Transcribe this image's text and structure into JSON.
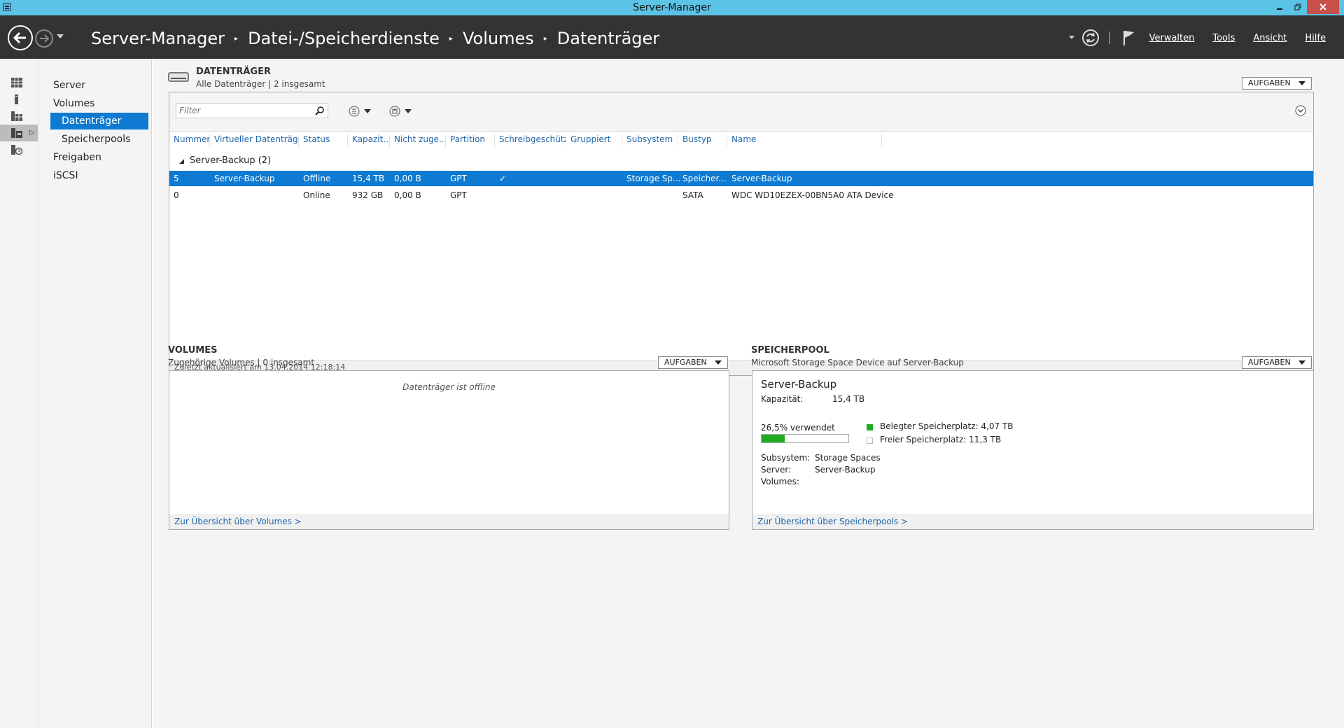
{
  "window": {
    "title": "Server-Manager"
  },
  "header": {
    "breadcrumb": [
      "Server-Manager",
      "Datei-/Speicherdienste",
      "Volumes",
      "Datenträger"
    ],
    "menu": [
      "Verwalten",
      "Tools",
      "Ansicht",
      "Hilfe"
    ]
  },
  "subnav": {
    "items": [
      {
        "label": "Server"
      },
      {
        "label": "Volumes"
      },
      {
        "label": "Datenträger",
        "active": true
      },
      {
        "label": "Speicherpools"
      },
      {
        "label": "Freigaben"
      },
      {
        "label": "iSCSI"
      }
    ]
  },
  "disks": {
    "title": "DATENTRÄGER",
    "subtitle": "Alle Datenträger | 2 insgesamt",
    "tasks_label": "AUFGABEN",
    "filter_placeholder": "Filter",
    "columns": [
      "Nummer",
      "Virtueller Datenträger",
      "Status",
      "Kapazit...",
      "Nicht zuge...",
      "Partition",
      "Schreibgeschützt",
      "Gruppiert",
      "Subsystem",
      "Bustyp",
      "Name"
    ],
    "group_label": "Server-Backup (2)",
    "rows": [
      {
        "nummer": "5",
        "virtuell": "Server-Backup",
        "status": "Offline",
        "kapazitaet": "15,4 TB",
        "nicht_zugeordnet": "0,00 B",
        "partition": "GPT",
        "schreibgeschuetzt": "✓",
        "gruppiert": "",
        "subsystem": "Storage Sp...",
        "bustyp": "Speicher...",
        "name": "Server-Backup",
        "selected": true
      },
      {
        "nummer": "0",
        "virtuell": "",
        "status": "Online",
        "kapazitaet": "932 GB",
        "nicht_zugeordnet": "0,00 B",
        "partition": "GPT",
        "schreibgeschuetzt": "",
        "gruppiert": "",
        "subsystem": "",
        "bustyp": "SATA",
        "name": "WDC WD10EZEX-00BN5A0 ATA Device",
        "selected": false
      }
    ],
    "footer": "Zuletzt aktualisiert am 13.04.2014 12:18:14"
  },
  "volumes": {
    "title": "VOLUMES",
    "subtitle": "Zugehörige Volumes | 0 insgesamt",
    "tasks_label": "AUFGABEN",
    "message": "Datenträger ist offline",
    "link": "Zur Übersicht über Volumes >"
  },
  "pool": {
    "title": "SPEICHERPOOL",
    "subtitle": "Microsoft Storage Space Device auf Server-Backup",
    "tasks_label": "AUFGABEN",
    "name": "Server-Backup",
    "capacity_label": "Kapazität:",
    "capacity_value": "15,4 TB",
    "used_text": "26,5% verwendet",
    "used_fraction": 0.265,
    "legend_used": "Belegter Speicherplatz: 4,07 TB",
    "legend_free": "Freier Speicherplatz: 11,3 TB",
    "subsystem_label": "Subsystem:",
    "subsystem_value": "Storage Spaces",
    "server_label": "Server:",
    "server_value": "Server-Backup",
    "volumes_label": "Volumes:",
    "link": "Zur Übersicht über Speicherpools >",
    "used_color": "#22aa22"
  },
  "colors": {
    "accent": "#0e7ad1",
    "titlebar": "#5bc3e5",
    "header": "#333333"
  }
}
